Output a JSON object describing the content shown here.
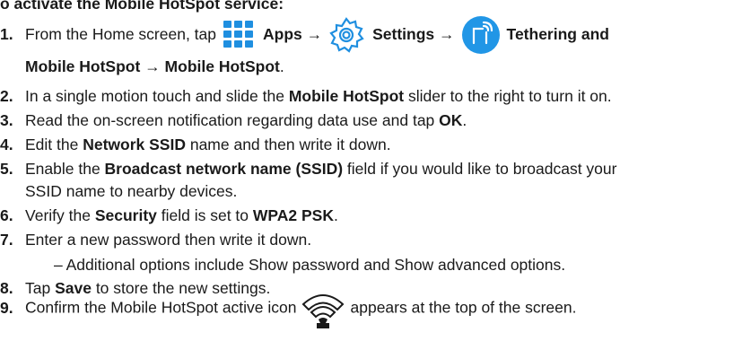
{
  "heading": "o activate the Mobile HotSpot service:",
  "step1": {
    "num": "1.",
    "t1": "From the Home screen, tap",
    "apps": "Apps",
    "arrow": "→",
    "settings": "Settings",
    "tether": "Tethering and",
    "line2_a": "Mobile HotSpot",
    "line2_arrow": " → ",
    "line2_b": "Mobile HotSpot",
    "line2_end": "."
  },
  "step2": {
    "num": "2.",
    "t1": "In a single motion touch and slide the ",
    "b1": "Mobile HotSpot",
    "t2": " slider to the right to turn it on."
  },
  "step3": {
    "num": "3.",
    "t1": "Read the on-screen notification regarding data use and tap ",
    "b1": "OK",
    "t2": "."
  },
  "step4": {
    "num": "4.",
    "t1": "Edit the ",
    "b1": "Network SSID",
    "t2": " name and then write it down."
  },
  "step5": {
    "num": "5.",
    "t1": "Enable the ",
    "b1": "Broadcast network name (SSID)",
    "t2": " field if you would like to broadcast your",
    "line2": "SSID name to nearby devices."
  },
  "step6": {
    "num": "6.",
    "t1": "Verify the ",
    "b1": "Security",
    "t2": " field is set to ",
    "b2": "WPA2 PSK",
    "t3": "."
  },
  "step7": {
    "num": "7.",
    "t1": "Enter a new password then write it down.",
    "sub": "– Additional options include Show password and Show advanced options."
  },
  "step8": {
    "num": "8.",
    "t1": "Tap ",
    "b1": "Save",
    "t2": " to store the new settings."
  },
  "step9": {
    "num": "9.",
    "t1": "Confirm the Mobile HotSpot active icon",
    "t2": "appears at the top of the screen."
  },
  "icons": {
    "apps": "apps-grid-icon",
    "settings": "settings-gear-icon",
    "tether": "tethering-hotspot-icon",
    "hotspot_status": "mobile-hotspot-active-icon"
  },
  "colors": {
    "icon_blue": "#1f8fe0",
    "tether_bg": "#2196e6",
    "text": "#1a1a1a"
  }
}
